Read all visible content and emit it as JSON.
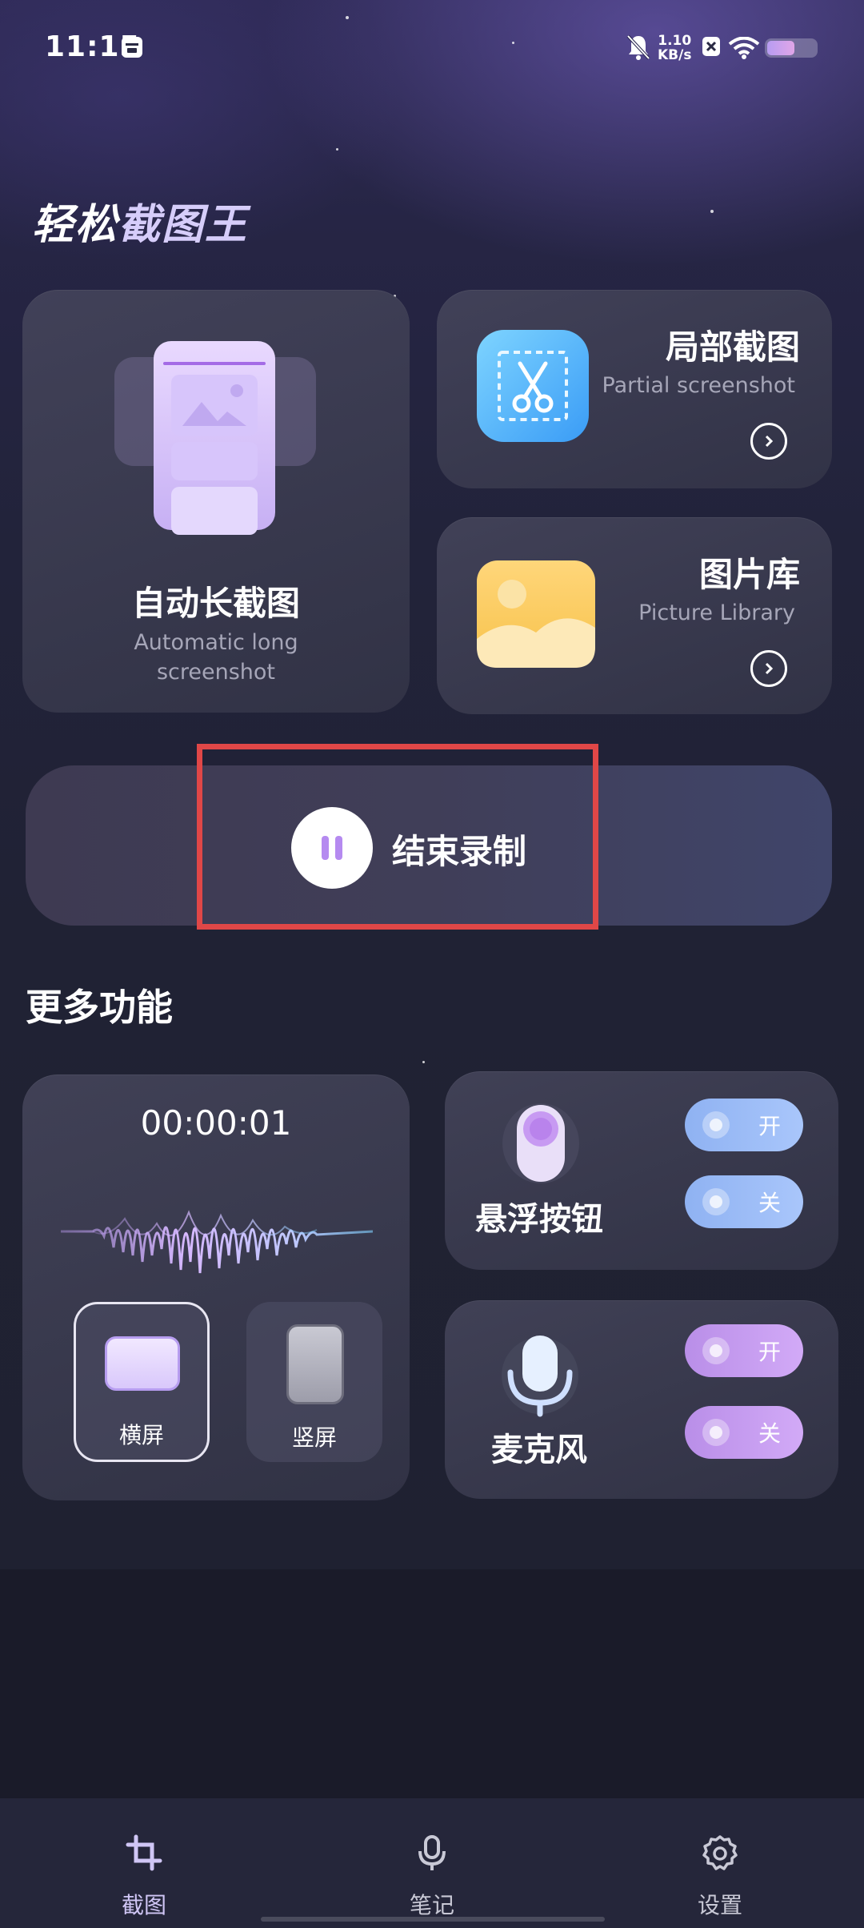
{
  "status_bar": {
    "time": "11:15",
    "net_speed_value": "1.10",
    "net_speed_unit": "KB/s"
  },
  "app": {
    "title_part1": "轻松",
    "title_part2": "截图王"
  },
  "cards": {
    "long_screenshot": {
      "title": "自动长截图",
      "subtitle": "Automatic long screenshot"
    },
    "partial": {
      "title": "局部截图",
      "subtitle": "Partial screenshot"
    },
    "library": {
      "title": "图片库",
      "subtitle": "Picture Library"
    }
  },
  "record": {
    "label": "结束录制"
  },
  "more": {
    "title": "更多功能",
    "timer": "00:00:01",
    "landscape": "横屏",
    "portrait": "竖屏",
    "float_button": {
      "label": "悬浮按钮",
      "on": "开",
      "off": "关"
    },
    "microphone": {
      "label": "麦克风",
      "on": "开",
      "off": "关"
    }
  },
  "nav": {
    "items": [
      {
        "label": "截图",
        "icon": "crop-icon",
        "active": true
      },
      {
        "label": "笔记",
        "icon": "microphone-icon",
        "active": false
      },
      {
        "label": "设置",
        "icon": "gear-icon",
        "active": false
      }
    ]
  },
  "colors": {
    "accent_purple": "#b58af0",
    "highlight_red": "#e04747",
    "toggle_blue": "#9bbcf6",
    "toggle_purple": "#c59df0"
  }
}
